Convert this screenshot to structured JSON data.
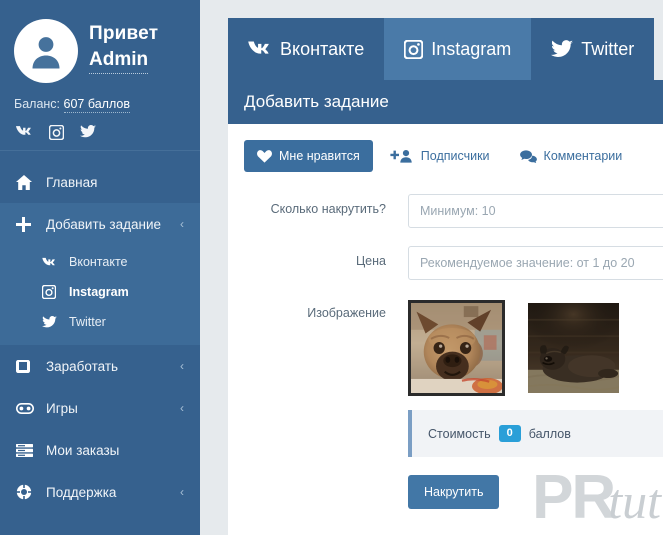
{
  "sidebar": {
    "profile": {
      "greeting": "Привет",
      "username": "Admin",
      "avatar_icon": "user-avatar-icon"
    },
    "balance": {
      "label": "Баланс:",
      "value": "607 баллов"
    },
    "social_links": [
      {
        "name": "vk",
        "icon": "vk-icon"
      },
      {
        "name": "instagram",
        "icon": "instagram-icon"
      },
      {
        "name": "twitter",
        "icon": "twitter-icon"
      }
    ],
    "items": [
      {
        "label": "Главная",
        "icon": "home-icon",
        "chevron": false,
        "active": false
      },
      {
        "label": "Добавить задание",
        "icon": "plus-icon",
        "chevron": true,
        "active": true
      },
      {
        "label": "Заработать",
        "icon": "book-icon",
        "chevron": true,
        "active": false
      },
      {
        "label": "Игры",
        "icon": "gamepad-icon",
        "chevron": true,
        "active": false
      },
      {
        "label": "Мои заказы",
        "icon": "list-icon",
        "chevron": false,
        "active": false
      },
      {
        "label": "Поддержка",
        "icon": "lifebuoy-icon",
        "chevron": true,
        "active": false
      }
    ],
    "submenu": [
      {
        "label": "Вконтакте",
        "icon": "vk-icon",
        "current": false
      },
      {
        "label": "Instagram",
        "icon": "instagram-icon",
        "current": true
      },
      {
        "label": "Twitter",
        "icon": "twitter-icon",
        "current": false
      }
    ],
    "chevron_glyph": "‹"
  },
  "tabs": [
    {
      "label": "Вконтакте",
      "icon": "vk-icon",
      "active": false
    },
    {
      "label": "Instagram",
      "icon": "instagram-icon",
      "active": true
    },
    {
      "label": "Twitter",
      "icon": "twitter-icon",
      "active": false
    }
  ],
  "panel": {
    "title": "Добавить задание",
    "subtabs": [
      {
        "label": "Мне нравится",
        "icon": "heart-icon",
        "active": true
      },
      {
        "label": "Подписчики",
        "icon": "add-user-icon",
        "active": false
      },
      {
        "label": "Комментарии",
        "icon": "comments-icon",
        "active": false
      }
    ],
    "form": {
      "amount": {
        "label": "Сколько накрутить?",
        "placeholder": "Минимум: 10",
        "value": ""
      },
      "price": {
        "label": "Цена",
        "placeholder": "Рекомендуемое значение: от 1 до 20",
        "value": ""
      },
      "image": {
        "label": "Изображение"
      }
    },
    "thumbnails": [
      {
        "name": "french-bulldog-photo",
        "selected": true
      },
      {
        "name": "dog-lying-photo",
        "selected": false
      }
    ],
    "cost": {
      "label": "Стоимость",
      "value": "0",
      "unit": "баллов"
    },
    "submit_label": "Накрутить"
  },
  "watermark": {
    "primary": "PR",
    "secondary": "tut"
  },
  "colors": {
    "sidebar_bg": "#36618e",
    "sidebar_active": "#3d6b98",
    "tab_active": "#4a7aa8",
    "accent": "#3b6e9e",
    "button": "#4277a6",
    "badge": "#2a9fd8",
    "page_bg": "#e6eaed"
  }
}
